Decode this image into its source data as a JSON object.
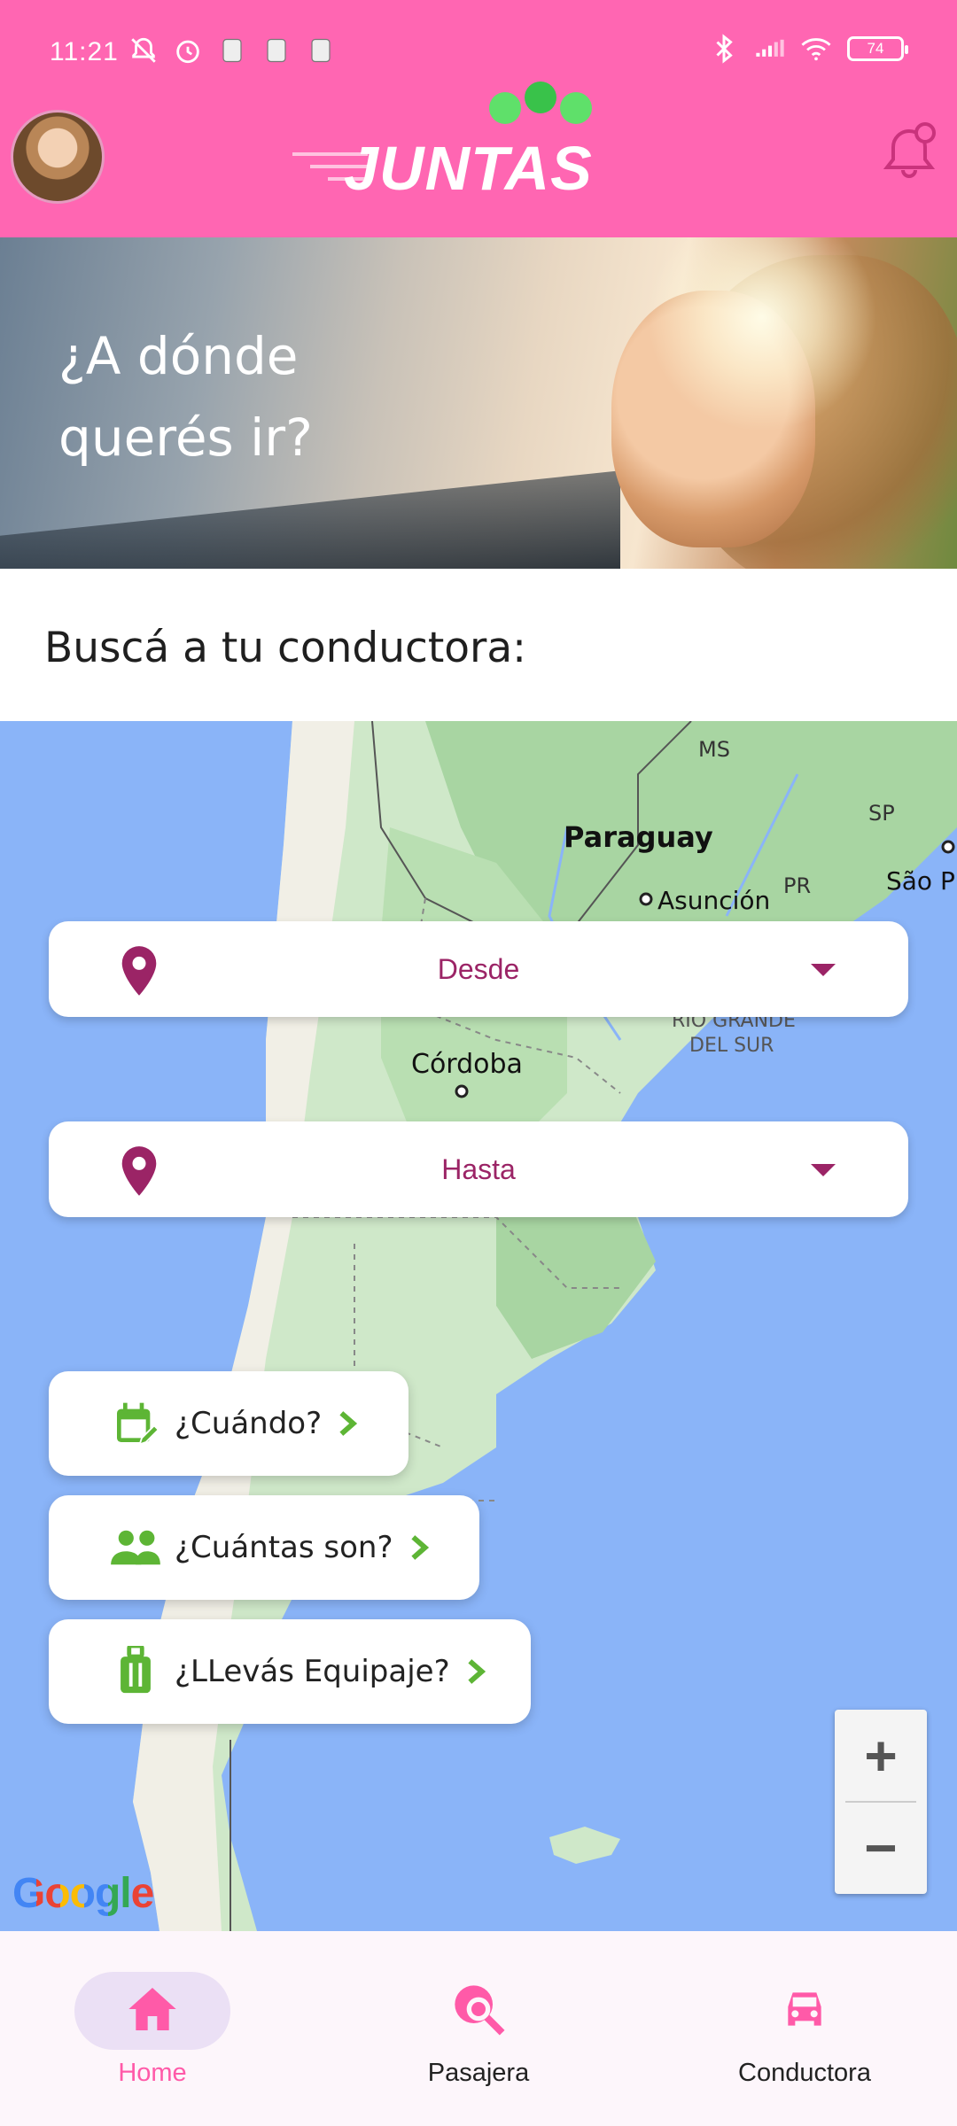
{
  "status_bar": {
    "time": "11:21",
    "battery": "74"
  },
  "header": {
    "logo_text": "JUNTAS"
  },
  "banner": {
    "title": "¿A dónde querés ir?"
  },
  "search": {
    "subtitle": "Buscá a tu conductora:"
  },
  "map": {
    "labels": {
      "ms": "MS",
      "paraguay": "Paraguay",
      "sp": "SP",
      "asuncion": "Asunción",
      "pr": "PR",
      "sao_paulo": "São P",
      "rio_grande": "RIO GRANDE",
      "del_sur": "DEL SUR",
      "cordoba": "Córdoba"
    },
    "from_field": {
      "label": "Desde"
    },
    "to_field": {
      "label": "Hasta"
    },
    "when_button": {
      "label": "¿Cuándo?"
    },
    "how_many_button": {
      "label": "¿Cuántas son?"
    },
    "luggage_button": {
      "label": "¿LLevás Equipaje?"
    },
    "zoom_in": "+",
    "zoom_out": "−",
    "attribution": "Google"
  },
  "bottom_nav": {
    "items": [
      {
        "label": "Home",
        "active": true
      },
      {
        "label": "Pasajera",
        "active": false
      },
      {
        "label": "Conductora",
        "active": false
      }
    ]
  },
  "colors": {
    "primary_pink": "#ff66b2",
    "accent_magenta": "#9b2466",
    "accent_green": "#5db535",
    "map_water": "#8ab4f8",
    "nav_active": "#ff5aa8"
  }
}
